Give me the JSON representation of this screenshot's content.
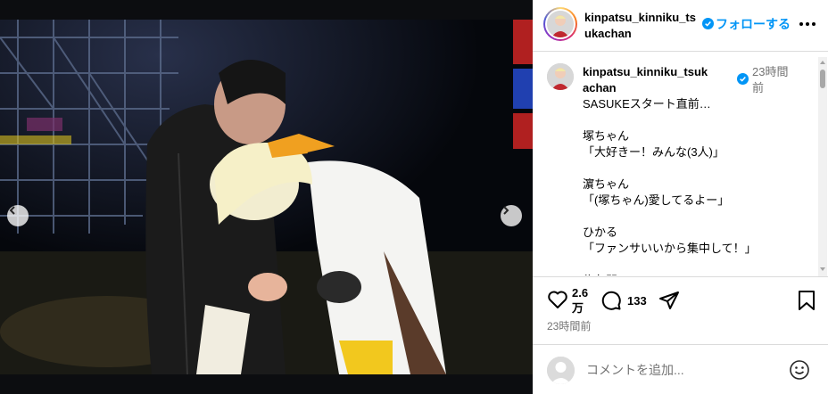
{
  "post": {
    "username": "kinpatsu_kinniku_tsukachan",
    "follow_label": "フォローする",
    "more_icon": "more-horizontal-icon"
  },
  "caption": {
    "username": "kinpatsu_kinniku_tsukachan",
    "time": "23時間前",
    "text": "SASUKEスタート直前…\n\n塚ちゃん\n「大好きー！みんな(3人)」\n\n濵ちゃん\n「(塚ちゃん)愛してるよー」\n\nひかる\n「ファンサいいから集中して！」\n\n佐久間"
  },
  "carousel": {
    "dots_total": 6,
    "active_dot": 3,
    "prev_icon": "chevron-left-icon",
    "next_icon": "chevron-right-icon"
  },
  "actions": {
    "like_count": "2.6万",
    "comment_count": "133",
    "post_time": "23時間前"
  },
  "comment_box": {
    "placeholder": "コメントを追加..."
  },
  "colors": {
    "accent": "#0095f6",
    "secondary_text": "#737373",
    "border": "#dbdbdb"
  }
}
